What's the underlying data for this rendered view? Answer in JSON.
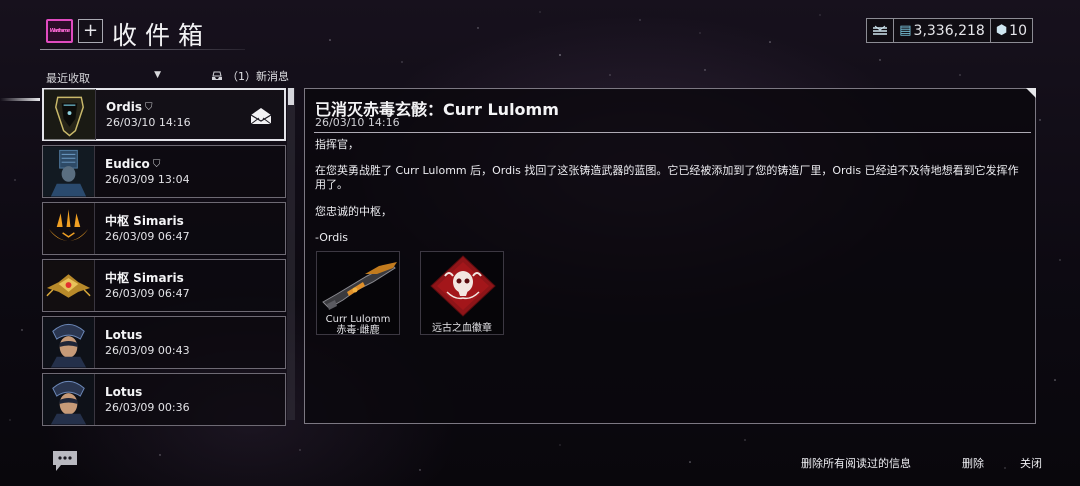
{
  "header": {
    "app_logo_text": "Warframe",
    "add_label": "+",
    "title": "收件箱",
    "credits_value": "3,336,218",
    "platinum_value": "10"
  },
  "sidebar": {
    "sort_label": "最近收取",
    "new_messages": "（1）新消息",
    "messages": [
      {
        "sender": "Ordis",
        "date": "26/03/10 14:16",
        "avatar": "ordis"
      },
      {
        "sender": "Eudico",
        "date": "26/03/09 13:04",
        "avatar": "eudico"
      },
      {
        "sender": "中枢 Simaris",
        "date": "26/03/09 06:47",
        "avatar": "simaris-emblem"
      },
      {
        "sender": "中枢 Simaris",
        "date": "26/03/09 06:47",
        "avatar": "simaris-ship"
      },
      {
        "sender": "Lotus",
        "date": "26/03/09 00:43",
        "avatar": "lotus"
      },
      {
        "sender": "Lotus",
        "date": "26/03/09 00:36",
        "avatar": "lotus"
      }
    ]
  },
  "detail": {
    "title": "已消灭赤毒玄骸：Curr Lulomm",
    "date": "26/03/10 14:16",
    "greeting": "指挥官，",
    "paragraph_line1": "在您英勇战胜了 Curr Lulomm 后，Ordis 找回了这张铸造武器的蓝图。它已经被添加到了您的铸造厂里，Ordis 已经迫不及待地想看到它发挥作",
    "paragraph_line2": "用了。",
    "signoff": "您忠诚的中枢，",
    "signature": "-Ordis",
    "attachments": [
      {
        "line1": "Curr Lulomm",
        "line2": "赤毒·雌鹿",
        "icon": "rifle-blueprint"
      },
      {
        "line1": "远古之血徽章",
        "line2": "",
        "icon": "skull-emblem"
      }
    ]
  },
  "footer": {
    "delete_read_label": "删除所有阅读过的信息",
    "delete_label": "删除",
    "close_label": "关闭"
  },
  "colors": {
    "logo_accent": "#e04bc0",
    "attachment_red": "#a3161a",
    "credits_cyan": "#7fd0e8"
  }
}
